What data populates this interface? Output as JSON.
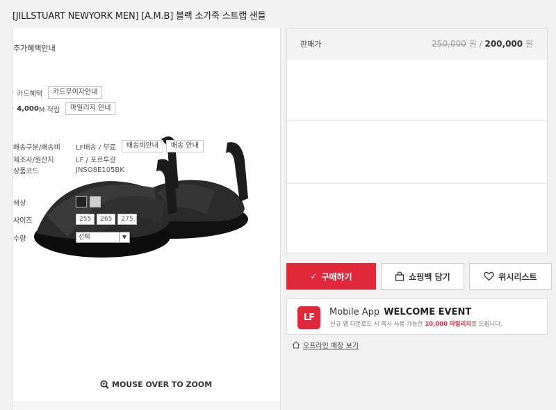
{
  "product": {
    "title": "[JILLSTUART NEWYORK MEN] [A.M.B] 블랙 소가죽 스트랩 샌들",
    "zoom_hint": "MOUSE OVER TO ZOOM"
  },
  "price": {
    "label": "판매가",
    "original": "250,000",
    "unit1": "원 /",
    "sale": "200,000",
    "unit2": "원"
  },
  "benefits": {
    "heading": "추가혜택안내",
    "card_label": "카드혜택",
    "card_button": "카드무이자안내",
    "mileage_amount": "4,000",
    "mileage_suffix": "M 적립",
    "mileage_button": "마일리지 안내"
  },
  "shipping": {
    "type_label": "배송구분/배송비",
    "type_value": "LF배송 / 무료",
    "fee_button": "배송비안내",
    "ship_button": "배송 안내",
    "maker_label": "제조사/원산지",
    "maker_value": "LF / 포르투갈",
    "code_label": "상품코드",
    "code_value": "JNSO8E105BK"
  },
  "options": {
    "color_label": "색상",
    "colors": [
      "#222222",
      "#cfcfcf"
    ],
    "size_label": "사이즈",
    "sizes": [
      "255",
      "265",
      "275"
    ],
    "qty_label": "수량",
    "qty_selected": "선택"
  },
  "actions": {
    "buy": "구매하기",
    "bag": "쇼핑백 담기",
    "wish": "위시리스트"
  },
  "banner": {
    "logo": "LF",
    "app": "Mobile App",
    "event": "WELCOME EVENT",
    "desc_pre": "신규 앱 다운로드 시 즉시 사용 가능한",
    "desc_highlight": "10,000 마일리지",
    "desc_post": "를 드립니다."
  },
  "offline_link": "오프라인 매장 보기",
  "colors": {
    "accent": "#e0283a"
  }
}
